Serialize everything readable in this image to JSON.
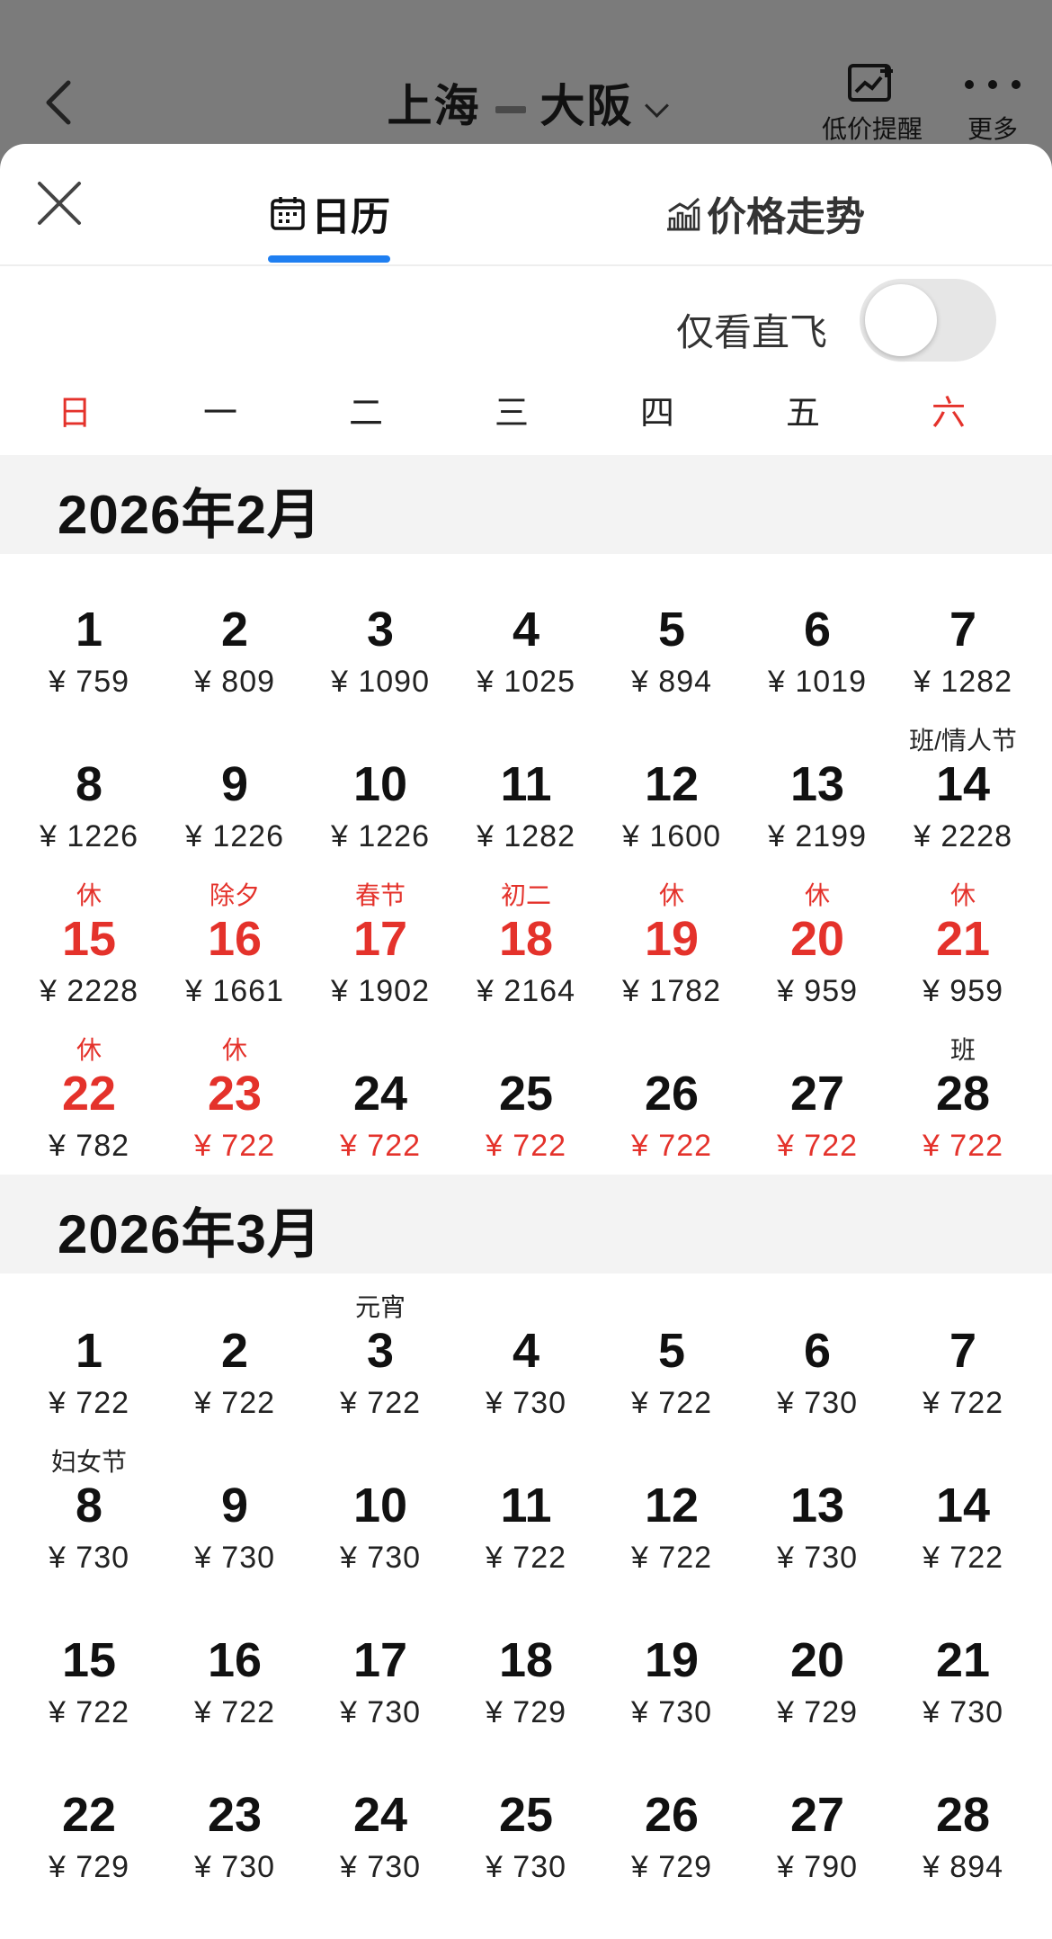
{
  "nav": {
    "origin": "上海",
    "destination": "大阪",
    "actions": [
      {
        "label": "低价提醒",
        "icon": "price-alert-icon"
      },
      {
        "label": "更多",
        "icon": "more-icon"
      }
    ]
  },
  "tabs": {
    "calendar": "日历",
    "trend": "价格走势",
    "active": "calendar"
  },
  "filter": {
    "direct_only_label": "仅看直飞",
    "direct_only_on": false
  },
  "weekdays": [
    "日",
    "一",
    "二",
    "三",
    "四",
    "五",
    "六"
  ],
  "colors": {
    "accent": "#1f7ff1",
    "holiday_red": "#e4322b",
    "month_bar": "#f3f3f3"
  },
  "months": [
    {
      "title": "2026年2月",
      "first_weekday": 0,
      "days": [
        {
          "day": "1",
          "price": "¥ 759",
          "tag": "",
          "holiday": false,
          "low": false
        },
        {
          "day": "2",
          "price": "¥ 809",
          "tag": "",
          "holiday": false,
          "low": false
        },
        {
          "day": "3",
          "price": "¥ 1090",
          "tag": "",
          "holiday": false,
          "low": false
        },
        {
          "day": "4",
          "price": "¥ 1025",
          "tag": "",
          "holiday": false,
          "low": false
        },
        {
          "day": "5",
          "price": "¥ 894",
          "tag": "",
          "holiday": false,
          "low": false
        },
        {
          "day": "6",
          "price": "¥ 1019",
          "tag": "",
          "holiday": false,
          "low": false
        },
        {
          "day": "7",
          "price": "¥ 1282",
          "tag": "",
          "holiday": false,
          "low": false
        },
        {
          "day": "8",
          "price": "¥ 1226",
          "tag": "",
          "holiday": false,
          "low": false
        },
        {
          "day": "9",
          "price": "¥ 1226",
          "tag": "",
          "holiday": false,
          "low": false
        },
        {
          "day": "10",
          "price": "¥ 1226",
          "tag": "",
          "holiday": false,
          "low": false
        },
        {
          "day": "11",
          "price": "¥ 1282",
          "tag": "",
          "holiday": false,
          "low": false
        },
        {
          "day": "12",
          "price": "¥ 1600",
          "tag": "",
          "holiday": false,
          "low": false
        },
        {
          "day": "13",
          "price": "¥ 2199",
          "tag": "",
          "holiday": false,
          "low": false
        },
        {
          "day": "14",
          "price": "¥ 2228",
          "tag": "班/情人节",
          "holiday": false,
          "low": false
        },
        {
          "day": "15",
          "price": "¥ 2228",
          "tag": "休",
          "holiday": true,
          "low": false
        },
        {
          "day": "16",
          "price": "¥ 1661",
          "tag": "除夕",
          "holiday": true,
          "low": false
        },
        {
          "day": "17",
          "price": "¥ 1902",
          "tag": "春节",
          "holiday": true,
          "low": false
        },
        {
          "day": "18",
          "price": "¥ 2164",
          "tag": "初二",
          "holiday": true,
          "low": false
        },
        {
          "day": "19",
          "price": "¥ 1782",
          "tag": "休",
          "holiday": true,
          "low": false
        },
        {
          "day": "20",
          "price": "¥ 959",
          "tag": "休",
          "holiday": true,
          "low": false
        },
        {
          "day": "21",
          "price": "¥ 959",
          "tag": "休",
          "holiday": true,
          "low": false
        },
        {
          "day": "22",
          "price": "¥ 782",
          "tag": "休",
          "holiday": true,
          "low": false
        },
        {
          "day": "23",
          "price": "¥ 722",
          "tag": "休",
          "holiday": true,
          "low": true
        },
        {
          "day": "24",
          "price": "¥ 722",
          "tag": "",
          "holiday": false,
          "low": true
        },
        {
          "day": "25",
          "price": "¥ 722",
          "tag": "",
          "holiday": false,
          "low": true
        },
        {
          "day": "26",
          "price": "¥ 722",
          "tag": "",
          "holiday": false,
          "low": true
        },
        {
          "day": "27",
          "price": "¥ 722",
          "tag": "",
          "holiday": false,
          "low": true
        },
        {
          "day": "28",
          "price": "¥ 722",
          "tag": "班",
          "holiday": false,
          "low": true
        }
      ]
    },
    {
      "title": "2026年3月",
      "first_weekday": 0,
      "days": [
        {
          "day": "1",
          "price": "¥ 722",
          "tag": "",
          "holiday": false,
          "low": false
        },
        {
          "day": "2",
          "price": "¥ 722",
          "tag": "",
          "holiday": false,
          "low": false
        },
        {
          "day": "3",
          "price": "¥ 722",
          "tag": "元宵",
          "holiday": false,
          "low": false
        },
        {
          "day": "4",
          "price": "¥ 730",
          "tag": "",
          "holiday": false,
          "low": false
        },
        {
          "day": "5",
          "price": "¥ 722",
          "tag": "",
          "holiday": false,
          "low": false
        },
        {
          "day": "6",
          "price": "¥ 730",
          "tag": "",
          "holiday": false,
          "low": false
        },
        {
          "day": "7",
          "price": "¥ 722",
          "tag": "",
          "holiday": false,
          "low": false
        },
        {
          "day": "8",
          "price": "¥ 730",
          "tag": "妇女节",
          "holiday": false,
          "low": false
        },
        {
          "day": "9",
          "price": "¥ 730",
          "tag": "",
          "holiday": false,
          "low": false
        },
        {
          "day": "10",
          "price": "¥ 730",
          "tag": "",
          "holiday": false,
          "low": false
        },
        {
          "day": "11",
          "price": "¥ 722",
          "tag": "",
          "holiday": false,
          "low": false
        },
        {
          "day": "12",
          "price": "¥ 722",
          "tag": "",
          "holiday": false,
          "low": false
        },
        {
          "day": "13",
          "price": "¥ 730",
          "tag": "",
          "holiday": false,
          "low": false
        },
        {
          "day": "14",
          "price": "¥ 722",
          "tag": "",
          "holiday": false,
          "low": false
        },
        {
          "day": "15",
          "price": "¥ 722",
          "tag": "",
          "holiday": false,
          "low": false
        },
        {
          "day": "16",
          "price": "¥ 722",
          "tag": "",
          "holiday": false,
          "low": false
        },
        {
          "day": "17",
          "price": "¥ 730",
          "tag": "",
          "holiday": false,
          "low": false
        },
        {
          "day": "18",
          "price": "¥ 729",
          "tag": "",
          "holiday": false,
          "low": false
        },
        {
          "day": "19",
          "price": "¥ 730",
          "tag": "",
          "holiday": false,
          "low": false
        },
        {
          "day": "20",
          "price": "¥ 729",
          "tag": "",
          "holiday": false,
          "low": false
        },
        {
          "day": "21",
          "price": "¥ 730",
          "tag": "",
          "holiday": false,
          "low": false
        },
        {
          "day": "22",
          "price": "¥ 729",
          "tag": "",
          "holiday": false,
          "low": false
        },
        {
          "day": "23",
          "price": "¥ 730",
          "tag": "",
          "holiday": false,
          "low": false
        },
        {
          "day": "24",
          "price": "¥ 730",
          "tag": "",
          "holiday": false,
          "low": false
        },
        {
          "day": "25",
          "price": "¥ 730",
          "tag": "",
          "holiday": false,
          "low": false
        },
        {
          "day": "26",
          "price": "¥ 729",
          "tag": "",
          "holiday": false,
          "low": false
        },
        {
          "day": "27",
          "price": "¥ 790",
          "tag": "",
          "holiday": false,
          "low": false
        },
        {
          "day": "28",
          "price": "¥ 894",
          "tag": "",
          "holiday": false,
          "low": false
        }
      ]
    }
  ]
}
